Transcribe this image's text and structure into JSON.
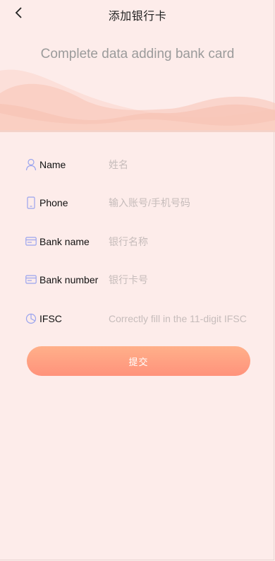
{
  "header": {
    "title": "添加银行卡",
    "back_icon": "chevron-left-icon"
  },
  "hero": {
    "subtitle": "Complete data adding bank card"
  },
  "form": {
    "fields": [
      {
        "icon": "user-icon",
        "label": "Name",
        "placeholder": "姓名"
      },
      {
        "icon": "phone-icon",
        "label": "Phone",
        "placeholder": "输入账号/手机号码"
      },
      {
        "icon": "card-icon",
        "label": "Bank name",
        "placeholder": "银行名称"
      },
      {
        "icon": "card-icon",
        "label": "Bank number",
        "placeholder": "银行卡号"
      },
      {
        "icon": "pie-chart-icon",
        "label": "IFSC",
        "placeholder": "Correctly fill in the 11-digit IFSC"
      }
    ],
    "submit_label": "提交"
  },
  "colors": {
    "background": "#fdecea",
    "accent": "#ff9f80",
    "icon": "#9aa4ee"
  }
}
